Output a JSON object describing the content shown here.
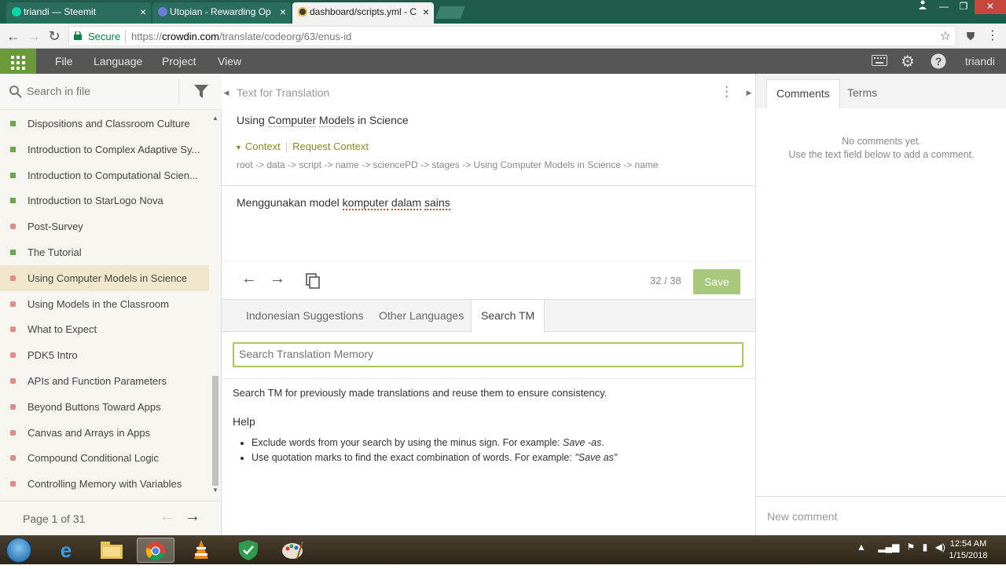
{
  "browser": {
    "tabs": [
      {
        "title": "triandi — Steemit",
        "favicon_color": "#06d6a9"
      },
      {
        "title": "Utopian - Rewarding Op",
        "favicon_color": "#6b7fd7"
      },
      {
        "title": "dashboard/scripts.yml - C",
        "favicon_color": "#3d3d3d"
      }
    ],
    "close_glyph": "×",
    "window_controls": {
      "minimize": "—",
      "restore": "❐",
      "close": "✕"
    },
    "secure_label": "Secure",
    "url_scheme": "https://",
    "url_host": "crowdin.com",
    "url_path": "/translate/codeorg/63/enus-id"
  },
  "app_header": {
    "menu": [
      "File",
      "Language",
      "Project",
      "View"
    ],
    "username": "triandi",
    "accent": "#6a9a3a"
  },
  "left_panel": {
    "search_placeholder": "Search in file",
    "items": [
      {
        "label": "Dispositions and Classroom Culture",
        "status": "green"
      },
      {
        "label": "Introduction to Complex Adaptive Sy...",
        "status": "green"
      },
      {
        "label": "Introduction to Computational Scien...",
        "status": "green"
      },
      {
        "label": "Introduction to StarLogo Nova",
        "status": "green"
      },
      {
        "label": "Post-Survey",
        "status": "red"
      },
      {
        "label": "The Tutorial",
        "status": "green"
      },
      {
        "label": "Using Computer Models in Science",
        "status": "red",
        "selected": true
      },
      {
        "label": "Using Models in the Classroom",
        "status": "red"
      },
      {
        "label": "What to Expect",
        "status": "red"
      },
      {
        "label": "PDK5 Intro",
        "status": "red"
      },
      {
        "label": "APIs and Function Parameters",
        "status": "red"
      },
      {
        "label": "Beyond Buttons Toward Apps",
        "status": "red"
      },
      {
        "label": "Canvas and Arrays in Apps",
        "status": "red"
      },
      {
        "label": "Compound Conditional Logic",
        "status": "red"
      },
      {
        "label": "Controlling Memory with Variables",
        "status": "red"
      }
    ],
    "page_label": "Page 1 of 31"
  },
  "source": {
    "title": "Text for Translation",
    "text_before": "Using ",
    "text_term1": "Computer",
    "text_middle": " ",
    "text_term2": "Models",
    "text_after": " in Science",
    "context_label": "Context",
    "request_context_label": "Request Context",
    "context_path": "root -> data -> script -> name -> sciencePD -> stages -> Using Computer Models in Science -> name"
  },
  "translation": {
    "text_before": "Menggunakan model ",
    "text_spell1": "komputer",
    "text_middle": " ",
    "text_spell2": "dalam",
    "text_space": " ",
    "text_spell3": "sains",
    "counter": "32 / 38",
    "save_label": "Save",
    "save_color": "#a8c97c"
  },
  "tm": {
    "tabs": [
      "Indonesian Suggestions",
      "Other Languages",
      "Search TM"
    ],
    "active_tab": "Search TM",
    "search_placeholder": "Search Translation Memory",
    "description": "Search TM for previously made translations and reuse them to ensure consistency.",
    "help_title": "Help",
    "help_1_text": "Exclude words from your search by using the minus sign. For example: ",
    "help_1_example": "Save -as",
    "help_1_end": ".",
    "help_2_text": "Use quotation marks to find the exact combination of words. For example: ",
    "help_2_example": "\"Save as\""
  },
  "right_panel": {
    "tabs": [
      "Comments",
      "Terms"
    ],
    "no_comments_line1": "No comments yet.",
    "no_comments_line2": "Use the text field below to add a comment.",
    "new_comment_placeholder": "New comment"
  },
  "taskbar": {
    "time": "12:54 AM",
    "date": "1/15/2018"
  }
}
